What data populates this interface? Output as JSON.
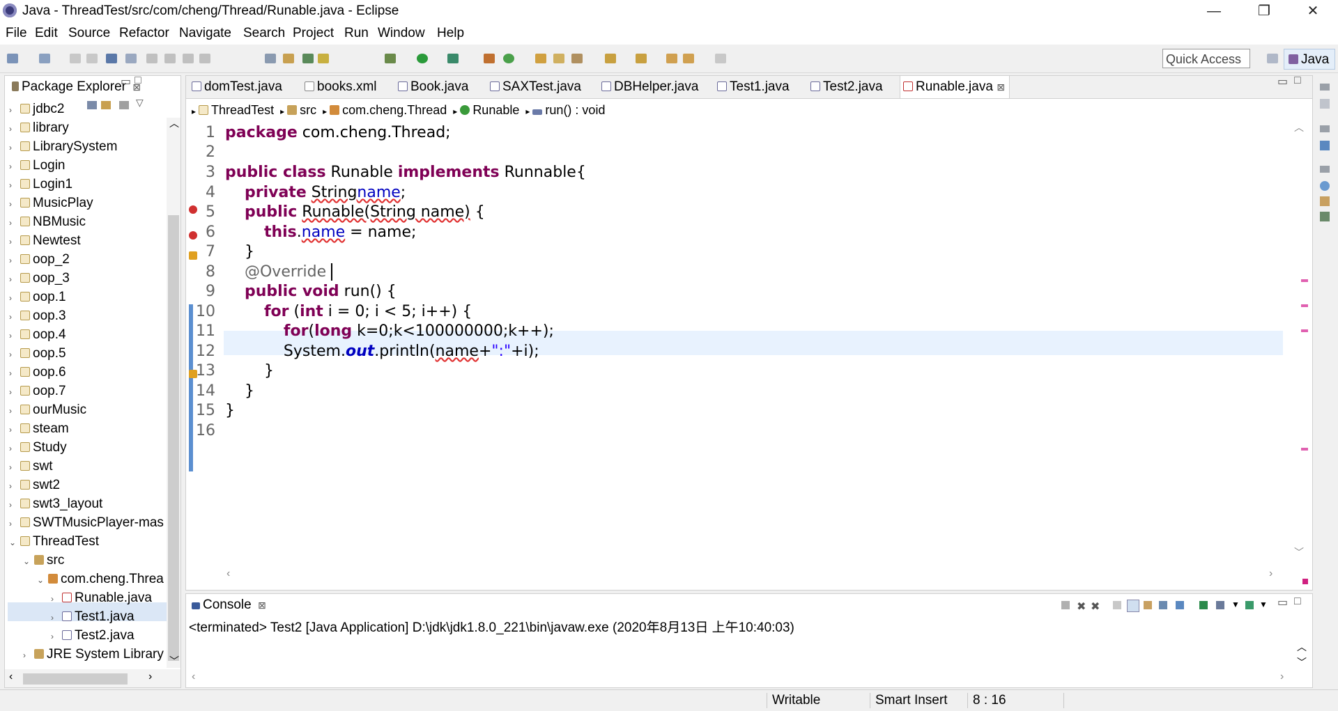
{
  "window": {
    "title": "Java - ThreadTest/src/com/cheng/Thread/Runable.java - Eclipse",
    "minimize": "—",
    "maximize": "❐",
    "close": "✕"
  },
  "menu": [
    "File",
    "Edit",
    "Source",
    "Refactor",
    "Navigate",
    "Search",
    "Project",
    "Run",
    "Window",
    "Help"
  ],
  "toolbar": {
    "quick_access": "Quick Access",
    "perspective": "Java"
  },
  "package_explorer": {
    "title": "Package Explorer",
    "close": "⊠",
    "items": [
      {
        "label": "jdbc2",
        "indent": 0,
        "expanded": false
      },
      {
        "label": "library",
        "indent": 0,
        "expanded": false
      },
      {
        "label": "LibrarySystem",
        "indent": 0,
        "expanded": false
      },
      {
        "label": "Login",
        "indent": 0,
        "expanded": false
      },
      {
        "label": "Login1",
        "indent": 0,
        "expanded": false
      },
      {
        "label": "MusicPlay",
        "indent": 0,
        "expanded": false
      },
      {
        "label": "NBMusic",
        "indent": 0,
        "expanded": false
      },
      {
        "label": "Newtest",
        "indent": 0,
        "expanded": false
      },
      {
        "label": "oop_2",
        "indent": 0,
        "expanded": false
      },
      {
        "label": "oop_3",
        "indent": 0,
        "expanded": false
      },
      {
        "label": "oop.1",
        "indent": 0,
        "expanded": false
      },
      {
        "label": "oop.3",
        "indent": 0,
        "expanded": false
      },
      {
        "label": "oop.4",
        "indent": 0,
        "expanded": false
      },
      {
        "label": "oop.5",
        "indent": 0,
        "expanded": false
      },
      {
        "label": "oop.6",
        "indent": 0,
        "expanded": false
      },
      {
        "label": "oop.7",
        "indent": 0,
        "expanded": false
      },
      {
        "label": "ourMusic",
        "indent": 0,
        "expanded": false
      },
      {
        "label": "steam",
        "indent": 0,
        "expanded": false
      },
      {
        "label": "Study",
        "indent": 0,
        "expanded": false
      },
      {
        "label": "swt",
        "indent": 0,
        "expanded": false
      },
      {
        "label": "swt2",
        "indent": 0,
        "expanded": false
      },
      {
        "label": "swt3_layout",
        "indent": 0,
        "expanded": false
      },
      {
        "label": "SWTMusicPlayer-mas",
        "indent": 0,
        "expanded": false
      },
      {
        "label": "ThreadTest",
        "indent": 0,
        "expanded": true
      },
      {
        "label": "src",
        "indent": 1,
        "expanded": true
      },
      {
        "label": "com.cheng.Threa",
        "indent": 2,
        "expanded": true
      },
      {
        "label": "Runable.java",
        "indent": 3,
        "expanded": false,
        "selected": true
      },
      {
        "label": "Test1.java",
        "indent": 3,
        "expanded": false
      },
      {
        "label": "Test2.java",
        "indent": 3,
        "expanded": false
      },
      {
        "label": "JRE System Library",
        "indent": 1,
        "expanded": false
      }
    ]
  },
  "editor": {
    "tabs": [
      {
        "label": "domTest.java"
      },
      {
        "label": "books.xml"
      },
      {
        "label": "Book.java"
      },
      {
        "label": "SAXTest.java"
      },
      {
        "label": "DBHelper.java"
      },
      {
        "label": "Test1.java"
      },
      {
        "label": "Test2.java"
      },
      {
        "label": "Runable.java",
        "active": true
      }
    ],
    "tab_close": "⊠",
    "breadcrumb": [
      "ThreadTest",
      "src",
      "com.cheng.Thread",
      "Runable",
      "run() : void"
    ],
    "line_numbers": [
      "1",
      "2",
      "3",
      "4",
      "5",
      "6",
      "7",
      "8",
      "9",
      "10",
      "11",
      "12",
      "13",
      "14",
      "15",
      "16"
    ]
  },
  "console": {
    "title": "Console",
    "close": "⊠",
    "output": "<terminated> Test2 [Java Application] D:\\jdk\\jdk1.8.0_221\\bin\\javaw.exe (2020年8月13日 上午10:40:03)"
  },
  "status": {
    "mode": "Writable",
    "insert": "Smart Insert",
    "position": "8 : 16"
  }
}
